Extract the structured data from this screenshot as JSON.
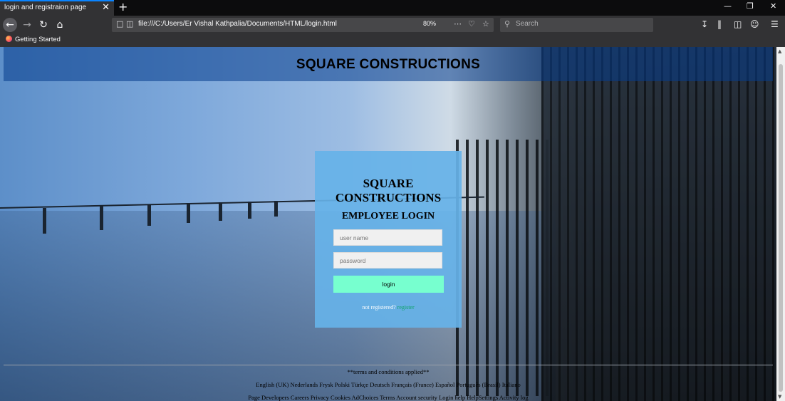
{
  "browser": {
    "tab_title": "login and registraion page",
    "tab_close": "✕",
    "new_tab": "+",
    "url": "file:///C:/Users/Er Vishal Kathpalia/Documents/HTML/login.html",
    "zoom": "80%",
    "search_placeholder": "Search",
    "bookmark": "Getting Started",
    "window_controls": [
      "—",
      "❐",
      "✕"
    ]
  },
  "page": {
    "header_title": "SQUARE CONSTRUCTIONS",
    "login": {
      "company_line1": "SQUARE",
      "company_line2": "CONSTRUCTIONS",
      "heading": "EMPLOYEE LOGIN",
      "username_placeholder": "user name",
      "password_placeholder": "password",
      "button": "login",
      "not_registered": "not registered?",
      "register_link": "register"
    },
    "footer": {
      "terms": "**terms and conditions applied**",
      "languages": "English (UK) Nederlands Frysk Polski Türkçe Deutsch Français (France) Español Português (Brasil) Italiano",
      "links": "Page Developers Careers Privacy Cookies AdChoices Terms Account security Login help HelpSettings Activity log"
    }
  },
  "colors": {
    "header_band": "#053c8c",
    "login_panel": "#66b2e8",
    "login_button": "#77ffcf",
    "register_link": "#0fa36a"
  }
}
